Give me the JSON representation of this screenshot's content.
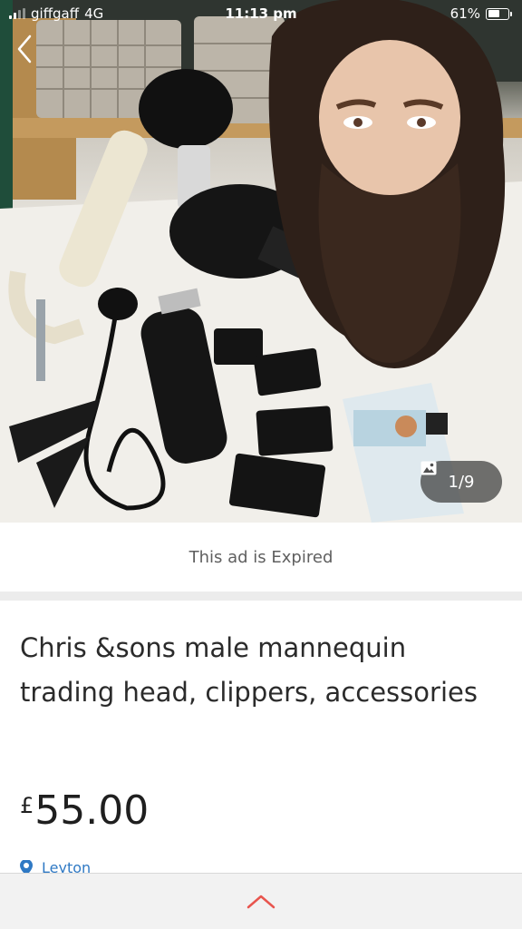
{
  "status_bar": {
    "carrier": "giffgaff",
    "network": "4G",
    "time": "11:13 pm",
    "battery": "61%",
    "battery_level": 0.61
  },
  "gallery": {
    "counter": "1/9",
    "back_icon": "chevron-left-icon",
    "counter_icon": "image-icon"
  },
  "notice": {
    "expired_text": "This ad is Expired"
  },
  "listing": {
    "title": "Chris &sons male mannequin trading head, clippers, accessories",
    "price_currency": "£",
    "price_amount": "55.00",
    "location": "Leyton",
    "location_icon": "map-pin-icon"
  },
  "bottom_bar": {
    "expand_icon": "chevron-up-icon"
  },
  "colors": {
    "accent_link": "#2f79c4",
    "expand_arrow": "#e8554e",
    "separator": "#ececec"
  }
}
